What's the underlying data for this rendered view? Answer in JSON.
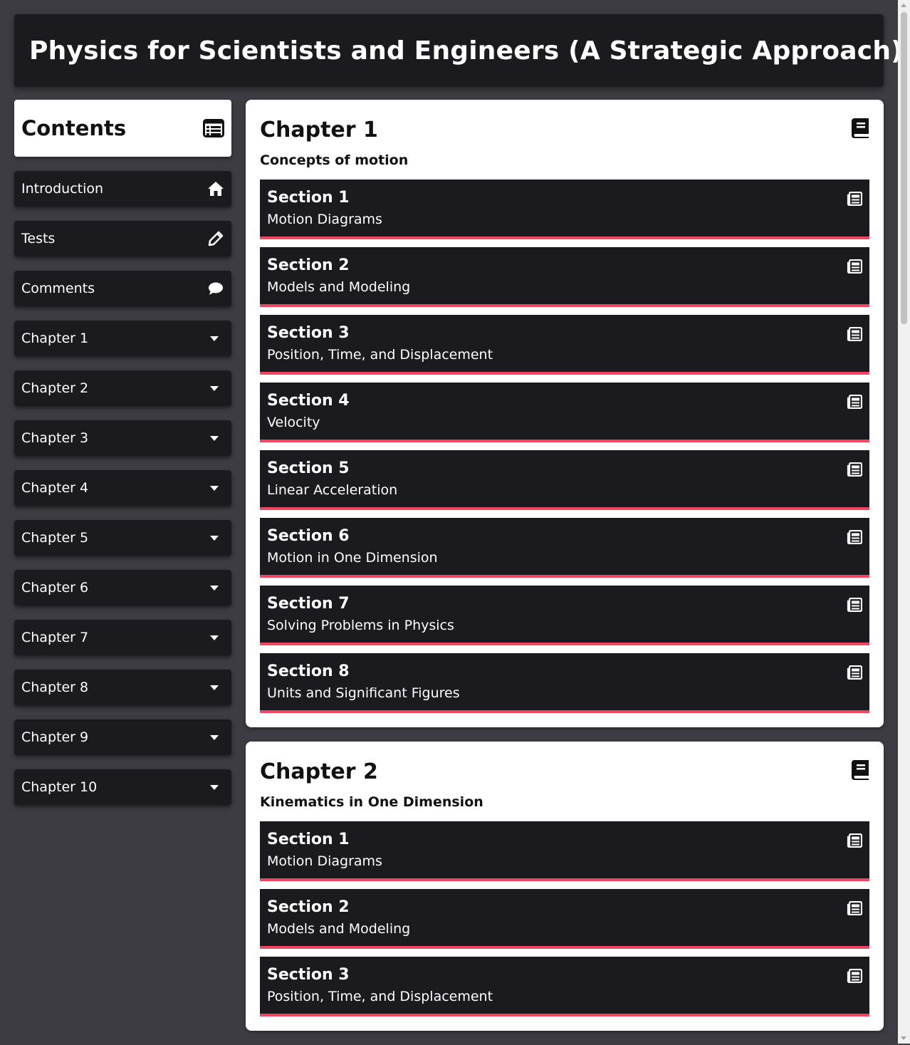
{
  "header": {
    "title": "Physics for Scientists and Engineers (A Strategic Approach)",
    "icon": "graduation-cap-icon"
  },
  "sidebar": {
    "title": "Contents",
    "title_icon": "table-list-icon",
    "items": [
      {
        "label": "Introduction",
        "icon": "home-icon"
      },
      {
        "label": "Tests",
        "icon": "pencil-icon"
      },
      {
        "label": "Comments",
        "icon": "comment-icon"
      },
      {
        "label": "Chapter 1",
        "icon": "caret-down-icon"
      },
      {
        "label": "Chapter 2",
        "icon": "caret-down-icon"
      },
      {
        "label": "Chapter 3",
        "icon": "caret-down-icon"
      },
      {
        "label": "Chapter 4",
        "icon": "caret-down-icon"
      },
      {
        "label": "Chapter 5",
        "icon": "caret-down-icon"
      },
      {
        "label": "Chapter 6",
        "icon": "caret-down-icon"
      },
      {
        "label": "Chapter 7",
        "icon": "caret-down-icon"
      },
      {
        "label": "Chapter 8",
        "icon": "caret-down-icon"
      },
      {
        "label": "Chapter 9",
        "icon": "caret-down-icon"
      },
      {
        "label": "Chapter 10",
        "icon": "caret-down-icon"
      }
    ]
  },
  "chapters": [
    {
      "title": "Chapter 1",
      "subtitle": "Concepts of motion",
      "sections": [
        {
          "title": "Section 1",
          "name": "Motion Diagrams"
        },
        {
          "title": "Section 2",
          "name": "Models and Modeling"
        },
        {
          "title": "Section 3",
          "name": "Position, Time, and Displacement"
        },
        {
          "title": "Section 4",
          "name": "Velocity"
        },
        {
          "title": "Section 5",
          "name": "Linear Acceleration"
        },
        {
          "title": "Section 6",
          "name": "Motion in One Dimension"
        },
        {
          "title": "Section 7",
          "name": "Solving Problems in Physics"
        },
        {
          "title": "Section 8",
          "name": "Units and Significant Figures"
        }
      ]
    },
    {
      "title": "Chapter 2",
      "subtitle": "Kinematics in One Dimension",
      "sections": [
        {
          "title": "Section 1",
          "name": "Motion Diagrams"
        },
        {
          "title": "Section 2",
          "name": "Models and Modeling"
        },
        {
          "title": "Section 3",
          "name": "Position, Time, and Displacement"
        }
      ]
    }
  ],
  "colors": {
    "background": "#3c3c42",
    "panel": "#1b1a1f",
    "accent": "#f24660"
  }
}
